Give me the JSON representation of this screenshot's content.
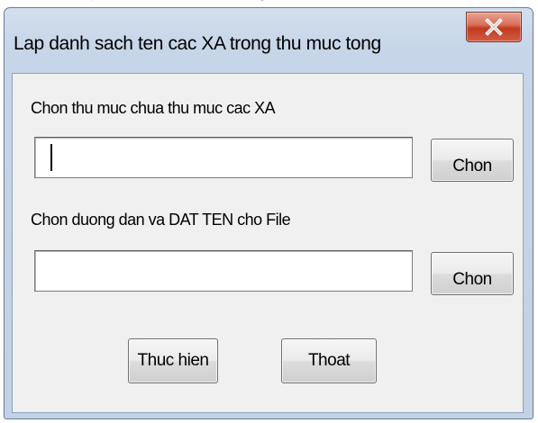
{
  "window": {
    "title": "Lap danh sach ten cac XA trong thu muc tong",
    "close_label": "X"
  },
  "form": {
    "folder_label": "Chon thu muc chua thu muc cac XA",
    "folder_value": "",
    "folder_browse_label": "Chon",
    "file_label": "Chon duong dan va DAT TEN cho File",
    "file_value": "",
    "file_browse_label": "Chon"
  },
  "actions": {
    "run_label": "Thuc hien",
    "exit_label": "Thoat"
  },
  "colors": {
    "window_frame": "#c6d5e8",
    "close_button": "#c2391f",
    "client_background": "#f0f0f0"
  }
}
